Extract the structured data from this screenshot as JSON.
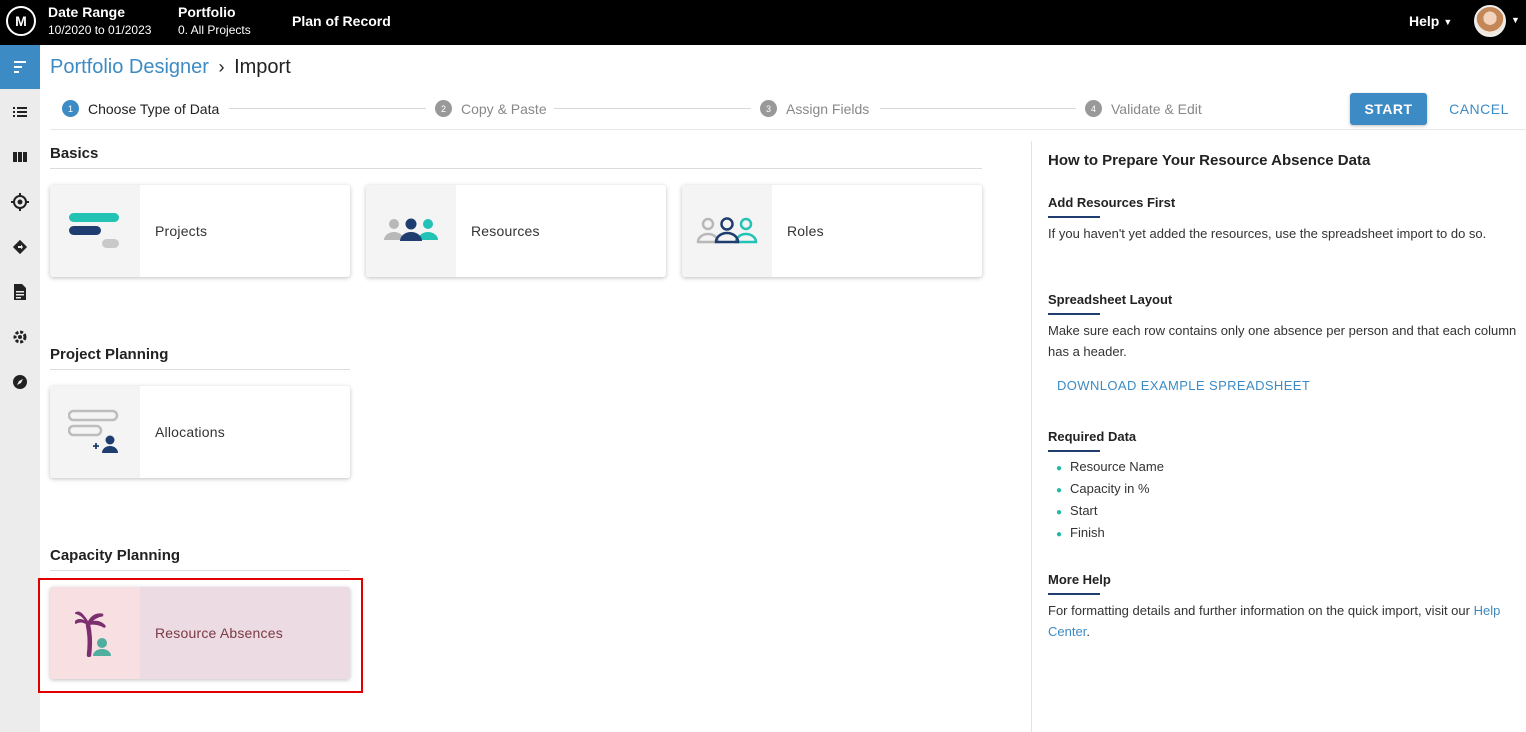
{
  "topbar": {
    "logo": "M",
    "date_range_label": "Date Range",
    "date_range_value": "10/2020 to 01/2023",
    "portfolio_label": "Portfolio",
    "portfolio_value": "0. All Projects",
    "plan": "Plan of Record",
    "help": "Help"
  },
  "rail_icons": [
    "menu-icon",
    "list-icon",
    "columns-icon",
    "target-icon",
    "roadmap-icon",
    "document-icon",
    "gear-icon",
    "compass-icon"
  ],
  "breadcrumb": {
    "parent": "Portfolio Designer",
    "separator": "›",
    "current": "Import"
  },
  "steps": [
    {
      "num": "1",
      "label": "Choose Type of Data"
    },
    {
      "num": "2",
      "label": "Copy & Paste"
    },
    {
      "num": "3",
      "label": "Assign Fields"
    },
    {
      "num": "4",
      "label": "Validate & Edit"
    }
  ],
  "actions": {
    "start": "START",
    "cancel": "CANCEL"
  },
  "sections": {
    "basics": {
      "title": "Basics",
      "cards": [
        "Projects",
        "Resources",
        "Roles"
      ]
    },
    "project_planning": {
      "title": "Project Planning",
      "cards": [
        "Allocations"
      ]
    },
    "capacity_planning": {
      "title": "Capacity Planning",
      "cards": [
        "Resource Absences"
      ]
    }
  },
  "help_panel": {
    "title": "How to Prepare Your Resource Absence Data",
    "add_resources": {
      "heading": "Add Resources First",
      "text": "If you haven't yet added the resources, use the spreadsheet import to do so."
    },
    "layout": {
      "heading": "Spreadsheet Layout",
      "text": "Make sure each row contains only one absence per person and that each column has a header.",
      "download": "DOWNLOAD EXAMPLE SPREADSHEET"
    },
    "required": {
      "heading": "Required Data",
      "items": [
        "Resource Name",
        "Capacity in %",
        "Start",
        "Finish"
      ]
    },
    "more_help": {
      "heading": "More Help",
      "text": "For formatting details and further information on the quick import, visit our ",
      "link": "Help Center",
      "suffix": "."
    }
  },
  "colors": {
    "accent": "#3d8bc4",
    "teal": "#22b8a8",
    "navy": "#1f3d6e",
    "highlight_frame": "#e00000"
  }
}
